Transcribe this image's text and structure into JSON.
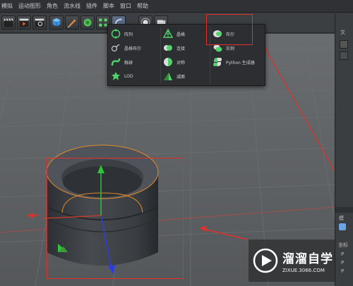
{
  "menubar": {
    "items": [
      "模拟",
      "运动图形",
      "角色",
      "流水线",
      "插件",
      "脚本",
      "窗口",
      "帮助"
    ]
  },
  "dropdown": {
    "col1": [
      {
        "icon": "array-icon",
        "label": "阵列"
      },
      {
        "icon": "atom-array-icon",
        "label": "晶格布尔"
      },
      {
        "icon": "spline-wrap-icon",
        "label": "融球"
      },
      {
        "icon": "lod-icon",
        "label": "LOD"
      }
    ],
    "col2": [
      {
        "icon": "lathe-icon",
        "label": "晶格"
      },
      {
        "icon": "connect-icon",
        "label": "连接"
      },
      {
        "icon": "symmetry-icon",
        "label": "对称"
      },
      {
        "icon": "reduction-icon",
        "label": "减面"
      }
    ],
    "col3": [
      {
        "icon": "boole-icon",
        "label": "布尔"
      },
      {
        "icon": "instance-icon",
        "label": "实例"
      },
      {
        "icon": "python-generator-icon",
        "label": "Python 生成器"
      }
    ]
  },
  "rightpanel": {
    "top_label": "文",
    "mode_label": "模",
    "coord_label": "坐标",
    "p_rows": [
      "P",
      "P",
      "P"
    ]
  },
  "watermark": {
    "title": "溜溜自学",
    "url": "ZIXUE.3066.COM"
  },
  "colors": {
    "accent_red": "#e0302a",
    "selection_orange": "#e08a2c",
    "axis_green": "#2fc43a",
    "axis_blue": "#2a3ee0",
    "axis_red": "#d83a2a"
  }
}
